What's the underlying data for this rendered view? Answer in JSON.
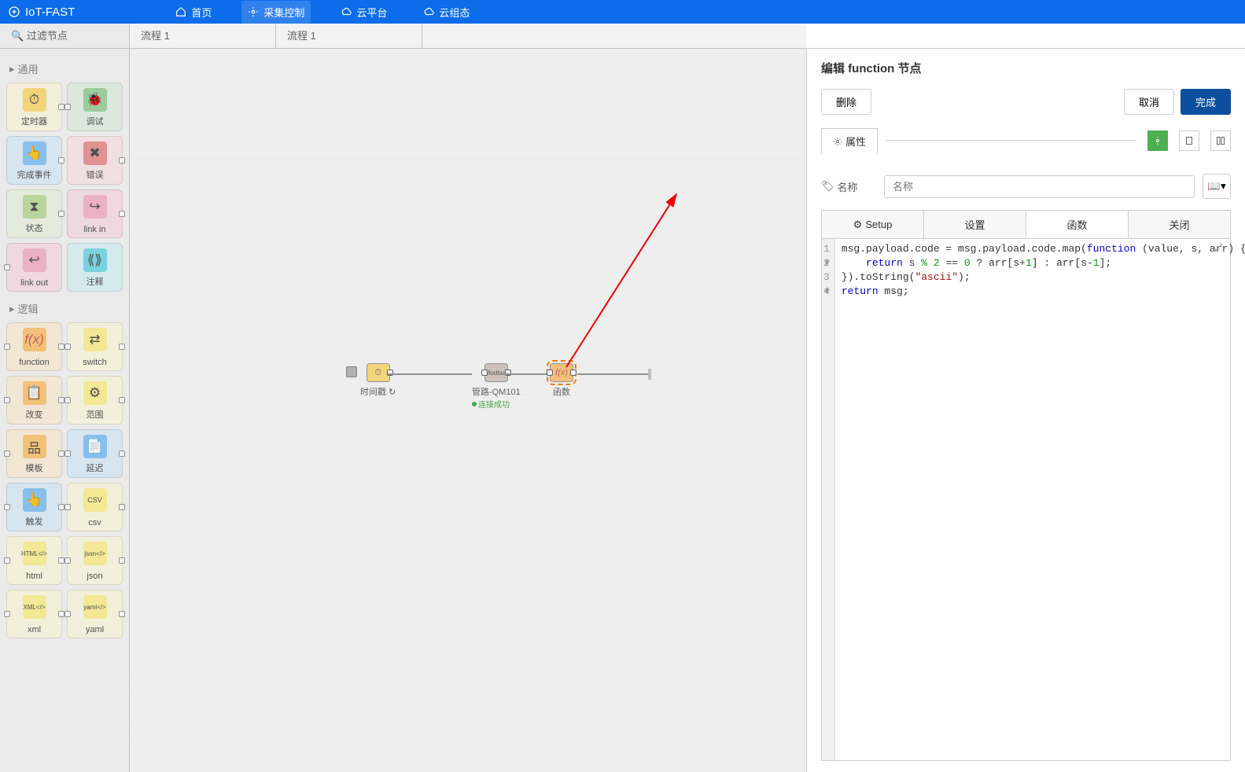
{
  "app_name": "IoT-FAST",
  "nav": {
    "home": "首页",
    "collect": "采集控制",
    "cloud": "云平台",
    "config": "云组态"
  },
  "tabs": {
    "filter": "过滤节点",
    "flow1": "流程 1",
    "flow1b": "流程 1"
  },
  "palette": {
    "cat_common": "通用",
    "cat_logic": "逻辑",
    "nodes": {
      "timer": "定时器",
      "debug": "调试",
      "complete": "完成事件",
      "error": "错误",
      "status": "状态",
      "linkin": "link in",
      "linkout": "link out",
      "comment": "注释",
      "function": "function",
      "switch": "switch",
      "change": "改变",
      "range": "范围",
      "template": "模板",
      "delay": "延迟",
      "trigger": "触发",
      "csv": "csv",
      "html": "html",
      "json": "json",
      "xml": "xml",
      "yaml": "yaml"
    }
  },
  "flow": {
    "n1": "时间戳",
    "n2": "管路-QM101",
    "n2_status": "连接成功",
    "n3": "函数"
  },
  "panel": {
    "title": "编辑 function 节点",
    "delete": "删除",
    "cancel": "取消",
    "done": "完成",
    "prop_tab": "属性",
    "name_label": "名称",
    "name_placeholder": "名称",
    "tab_setup": "Setup",
    "tab_set": "设置",
    "tab_func": "函数",
    "tab_close": "关闭"
  },
  "code": {
    "lines": [
      "1",
      "2",
      "3",
      "4"
    ],
    "markers": [
      "▾",
      " ",
      "▾",
      " "
    ],
    "l1_a": "msg.payload.code = msg.payload.code.map(",
    "l1_kw": "function",
    "l1_b": " (value, s, arr) {",
    "l2_a": "    ",
    "l2_kw": "return",
    "l2_b": " s ",
    "l2_op": "%",
    "l2_c": " ",
    "l2_n1": "2",
    "l2_d": " == ",
    "l2_n2": "0",
    "l2_e": " ? arr[s+",
    "l2_n3": "1",
    "l2_f": "] : arr[s-",
    "l2_n4": "1",
    "l2_g": "];",
    "l3_a": "}).toString(",
    "l3_s": "\"ascii\"",
    "l3_b": ");",
    "l4_kw": "return",
    "l4_a": " msg;"
  }
}
